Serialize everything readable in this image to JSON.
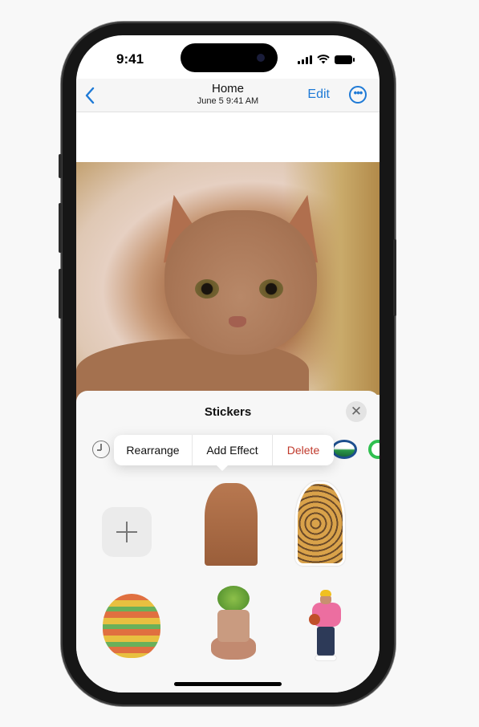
{
  "status_bar": {
    "time": "9:41"
  },
  "navbar": {
    "back_icon": "chevron-left-icon",
    "title": "Home",
    "subtitle": "June 5  9:41 AM",
    "edit_label": "Edit",
    "more_icon": "ellipsis-circle-icon",
    "more_glyph": "•••",
    "accent_color": "#1f7ad6"
  },
  "photo": {
    "subject": "orange cat"
  },
  "stickers_sheet": {
    "title": "Stickers",
    "close_glyph": "✕",
    "tabs": [
      {
        "icon": "recents-clock-icon"
      },
      {
        "icon": "app-sticker-pack-icon"
      },
      {
        "icon": "app-sticker-pack-green-icon"
      }
    ],
    "context_menu": {
      "items": [
        {
          "label": "Rearrange"
        },
        {
          "label": "Add Effect"
        },
        {
          "label": "Delete",
          "color": "#c0392b"
        }
      ]
    },
    "stickers": [
      {
        "type": "add",
        "label": "Add sticker"
      },
      {
        "type": "sticker",
        "subject": "cat"
      },
      {
        "type": "sticker",
        "subject": "giraffe"
      },
      {
        "type": "sticker",
        "subject": "hot air balloon"
      },
      {
        "type": "sticker",
        "subject": "plant pot character"
      },
      {
        "type": "sticker",
        "subject": "person with basketball"
      }
    ]
  }
}
